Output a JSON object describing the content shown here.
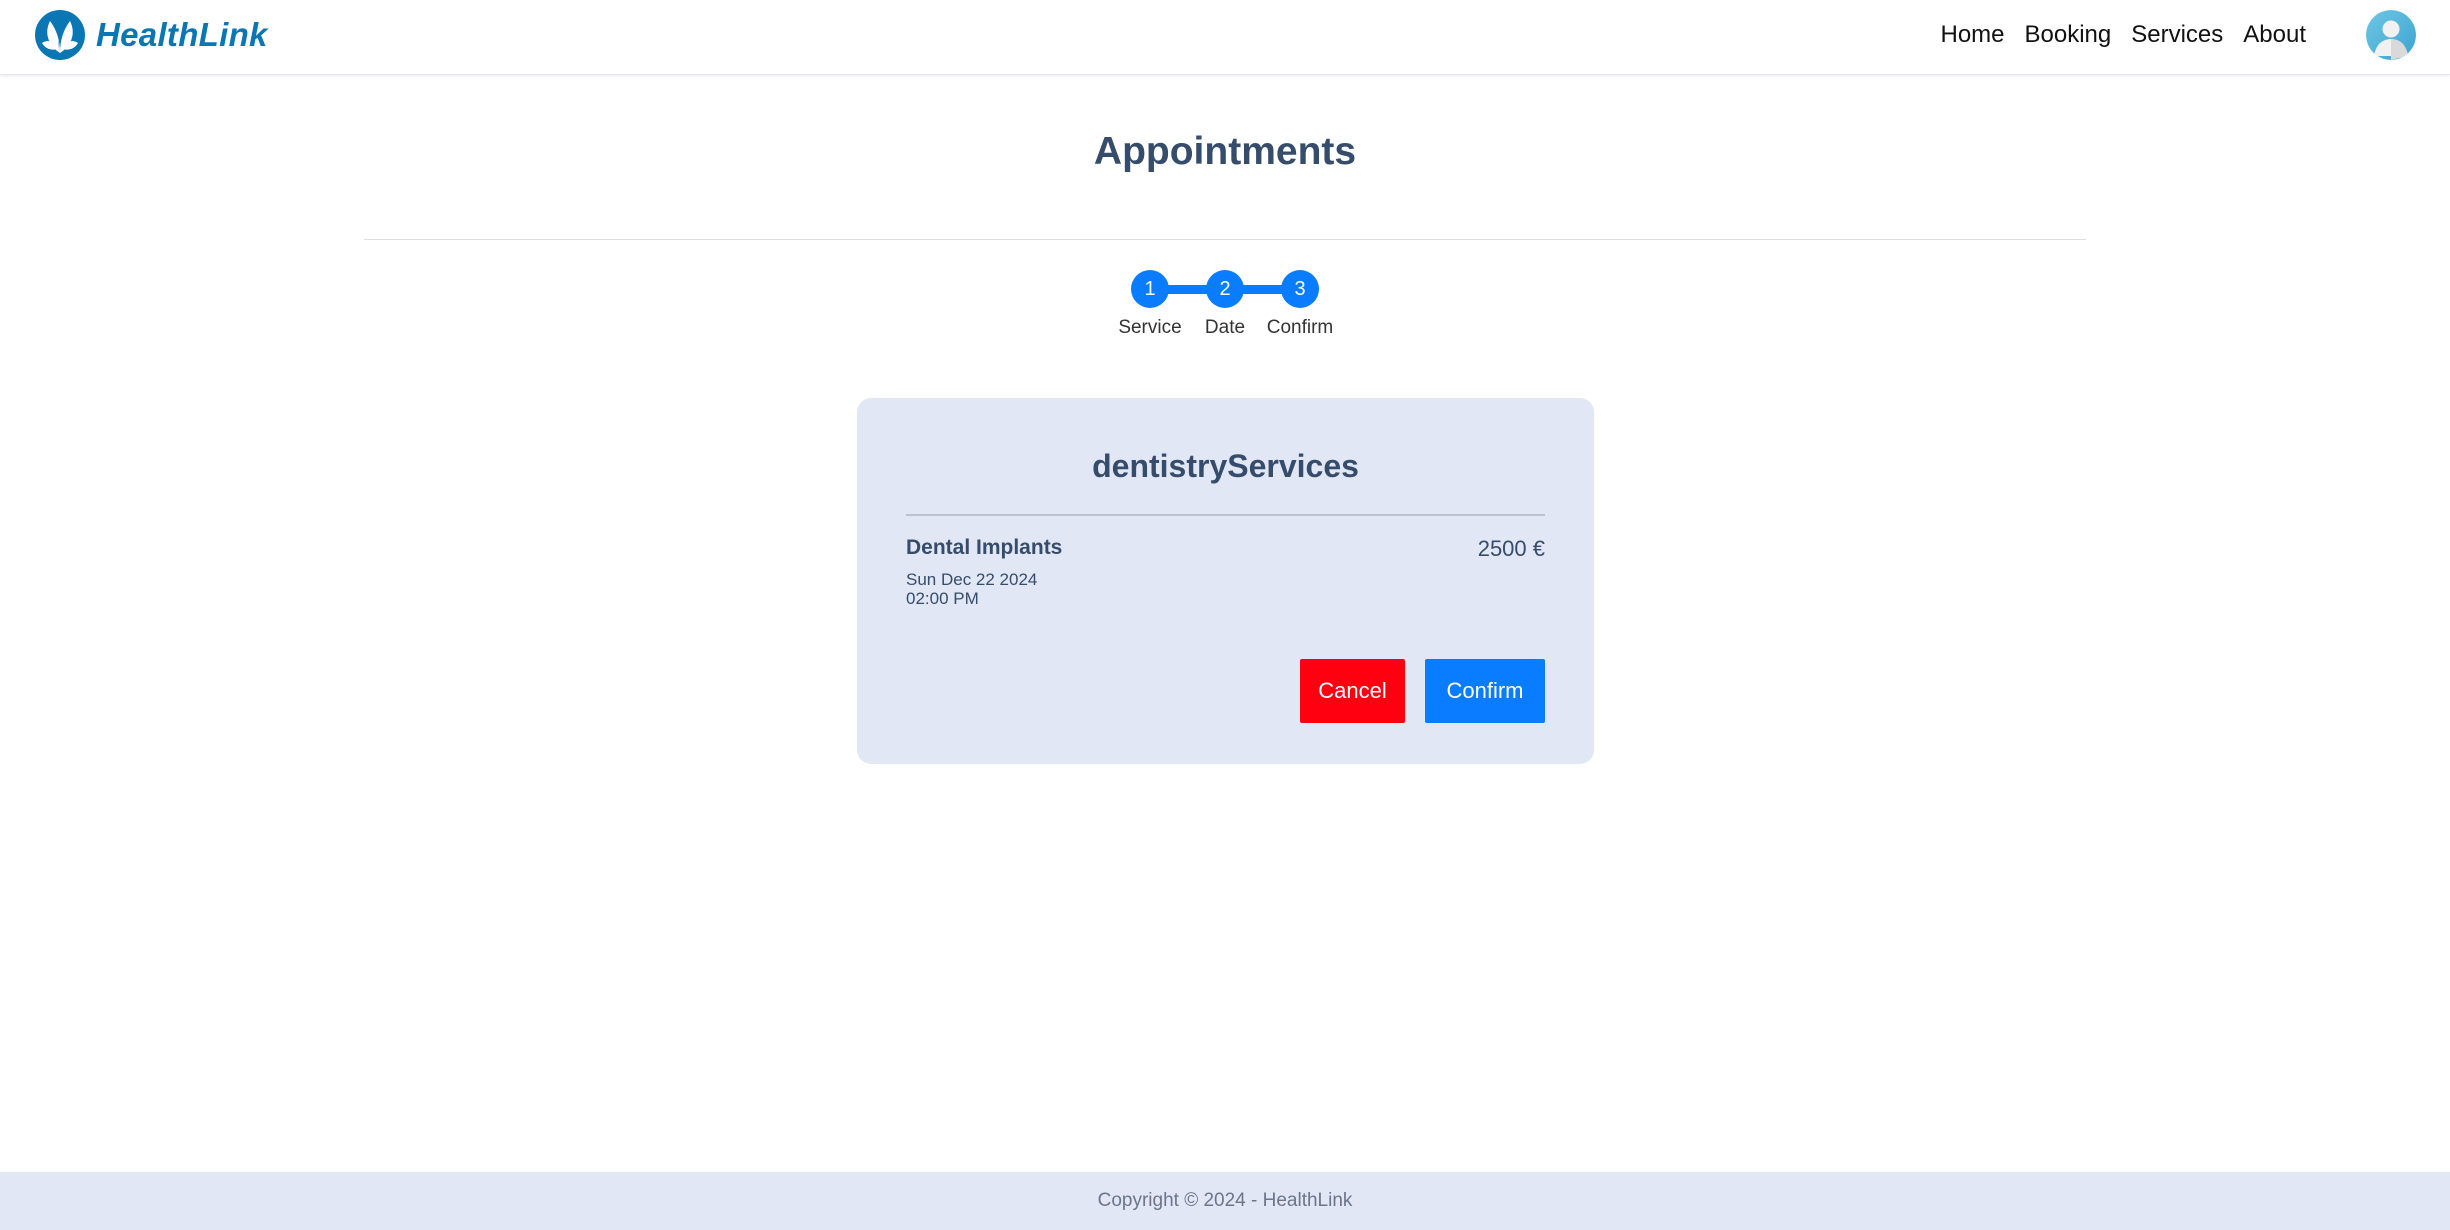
{
  "header": {
    "brand_name": "HealthLink",
    "logo_icon": "leaf-logo-icon",
    "nav": {
      "home": "Home",
      "booking": "Booking",
      "services": "Services",
      "about": "About"
    },
    "avatar_icon": "user-avatar-icon"
  },
  "main": {
    "title": "Appointments",
    "stepper": {
      "steps": [
        {
          "number": "1",
          "label": "Service"
        },
        {
          "number": "2",
          "label": "Date"
        },
        {
          "number": "3",
          "label": "Confirm"
        }
      ],
      "active_color": "#0a7cff"
    },
    "card": {
      "title": "dentistryServices",
      "service_name": "Dental Implants",
      "price": "2500 €",
      "date": "Sun Dec 22 2024",
      "time": "02:00 PM",
      "cancel_label": "Cancel",
      "confirm_label": "Confirm"
    }
  },
  "footer": {
    "copyright": "Copyright © 2024 - HealthLink"
  },
  "colors": {
    "brand": "#0a77b4",
    "primary": "#0a7cff",
    "danger": "#ff0010",
    "card_bg": "#e1e7f4",
    "heading": "#364c6b"
  }
}
